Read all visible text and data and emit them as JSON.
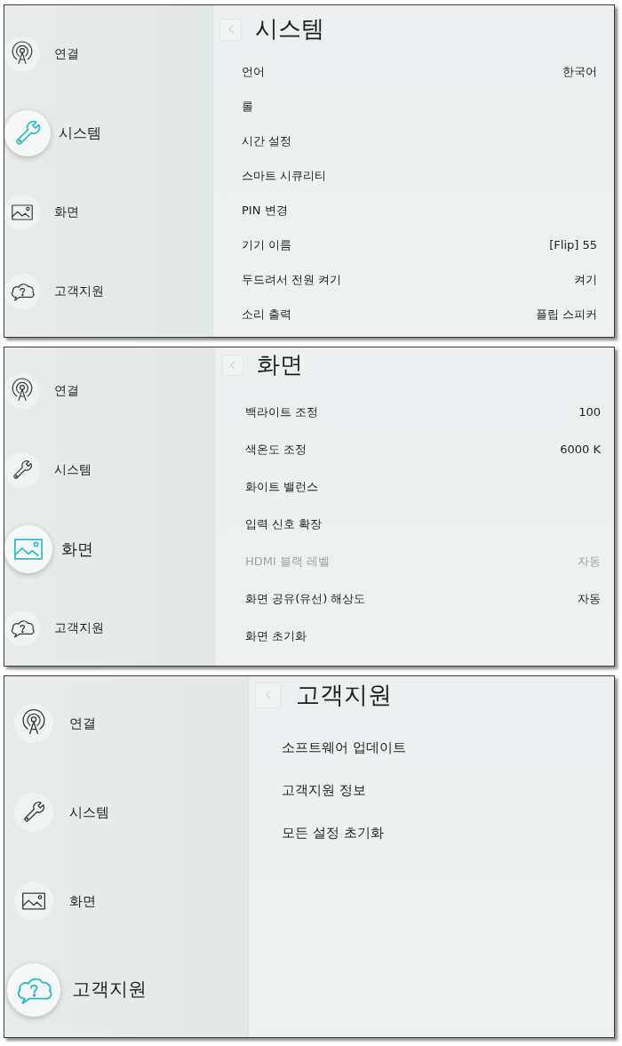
{
  "screens": [
    {
      "sidebar": [
        {
          "kind": "antenna",
          "label": "연결",
          "selected": false
        },
        {
          "kind": "wrench",
          "label": "시스템",
          "selected": true
        },
        {
          "kind": "picture",
          "label": "화면",
          "selected": false
        },
        {
          "kind": "cloud",
          "label": "고객지원",
          "selected": false
        }
      ],
      "title": "시스템",
      "items": [
        {
          "label": "언어",
          "value": "한국어",
          "disabled": false
        },
        {
          "label": "롤",
          "disabled": false
        },
        {
          "label": "시간 설정",
          "disabled": false
        },
        {
          "label": "스마트 시큐리티",
          "disabled": false
        },
        {
          "label": "PIN 변경",
          "disabled": false
        },
        {
          "label": "기기 이름",
          "value": "[Flip] 55",
          "disabled": false
        },
        {
          "label": "두드려서 전원 켜기",
          "value": "켜기",
          "disabled": false
        },
        {
          "label": "소리 출력",
          "value": "플립 스피커",
          "disabled": false
        }
      ]
    },
    {
      "sidebar": [
        {
          "kind": "antenna",
          "label": "연결",
          "selected": false
        },
        {
          "kind": "wrench",
          "label": "시스템",
          "selected": false
        },
        {
          "kind": "picture",
          "label": "화면",
          "selected": true
        },
        {
          "kind": "cloud",
          "label": "고객지원",
          "selected": false
        }
      ],
      "title": "화면",
      "items": [
        {
          "label": "백라이트 조정",
          "value": "100",
          "disabled": false
        },
        {
          "label": "색온도 조정",
          "value": "6000 K",
          "disabled": false
        },
        {
          "label": "화이트 밸런스",
          "disabled": false
        },
        {
          "label": "입력 신호 확장",
          "disabled": false
        },
        {
          "label": "HDMI 블랙 레벨",
          "value": "자동",
          "disabled": true
        },
        {
          "label": "화면 공유(유선) 해상도",
          "value": "자동",
          "disabled": false
        },
        {
          "label": "화면 초기화",
          "disabled": false
        }
      ]
    },
    {
      "sidebar": [
        {
          "kind": "antenna",
          "label": "연결",
          "selected": false
        },
        {
          "kind": "wrench",
          "label": "시스템",
          "selected": false
        },
        {
          "kind": "picture",
          "label": "화면",
          "selected": false
        },
        {
          "kind": "cloud",
          "label": "고객지원",
          "selected": true
        }
      ],
      "title": "고객지원",
      "items": [
        {
          "label": "소프트웨어 업데이트",
          "disabled": false
        },
        {
          "label": "고객지원 정보",
          "disabled": false
        },
        {
          "label": "모든 설정 초기화",
          "disabled": false
        }
      ]
    }
  ]
}
